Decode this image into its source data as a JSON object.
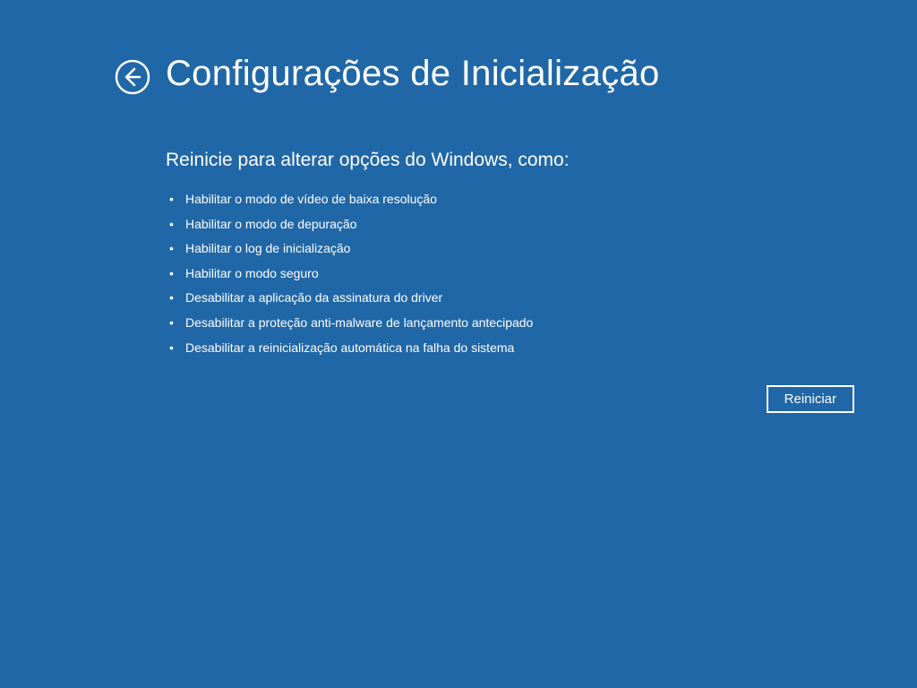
{
  "title": "Configurações de Inicialização",
  "subtitle": "Reinicie para alterar opções do Windows, como:",
  "options": [
    "Habilitar o modo de vídeo de baixa resolução",
    "Habilitar o modo de depuração",
    "Habilitar o log de inicialização",
    "Habilitar o modo seguro",
    "Desabilitar a aplicação da assinatura do driver",
    "Desabilitar a proteção anti-malware de lançamento antecipado",
    "Desabilitar a reinicialização automática na falha do sistema"
  ],
  "restart_label": "Reiniciar"
}
